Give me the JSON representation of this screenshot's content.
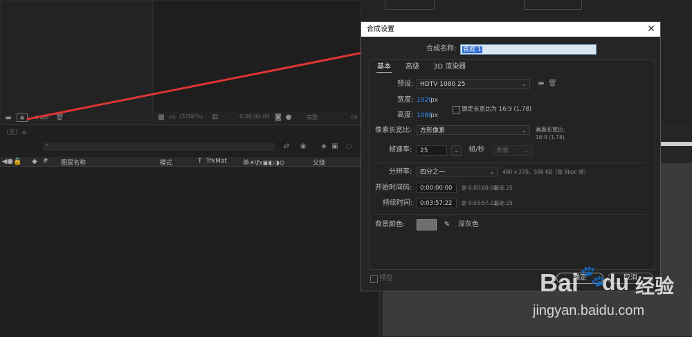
{
  "viewer": {
    "bpc_label": "8 bpc",
    "zoom_label": "(3700%)",
    "timecode": "0:00:00:00",
    "quality": "完整"
  },
  "timeline": {
    "comp_name": "（无）≡",
    "columns": {
      "hash": "#",
      "layer_name": "图层名称",
      "mode": "模式",
      "t": "T",
      "trkmat": "TrkMat",
      "switches": "单☀\\fx▣◐◑⊙",
      "parent": "父级"
    }
  },
  "dialog": {
    "title": "合成设置",
    "comp_name_label": "合成名称:",
    "comp_name_value": "合成 1",
    "tabs": [
      "基本",
      "高级",
      "3D 渲染器"
    ],
    "preset_label": "预设:",
    "preset_value": "HDTV 1080 25",
    "width_label": "宽度:",
    "width_value": "1920",
    "width_unit": "px",
    "height_label": "高度:",
    "height_value": "1080",
    "height_unit": "px",
    "lock_aspect_label": "锁定长宽比为 16:9 (1.78)",
    "pixel_aspect_label": "像素长宽比:",
    "pixel_aspect_value": "方形像素",
    "frame_aspect_label": "画面长宽比:",
    "frame_aspect_value": "16:9 (1.78)",
    "frame_rate_label": "帧速率:",
    "frame_rate_value": "25",
    "frame_rate_unit": "帧/秒",
    "drop_frame_value": "丢帧",
    "resolution_label": "分辨率:",
    "resolution_value": "四分之一",
    "resolution_info": "480 x 270，506 KB（每 8bpc 帧）",
    "start_tc_label": "开始时间码:",
    "start_tc_value": "0:00:00:00",
    "start_tc_info": "是 0:00:00:00",
    "start_tc_base": "基础 25",
    "duration_label": "持续时间:",
    "duration_value": "0:03:57:22",
    "duration_info": "是 0:03:57:22",
    "duration_base": "基础 25",
    "bg_color_label": "背景颜色:",
    "bg_color_name": "深灰色",
    "bg_color_hex": "#6e6e6e",
    "preview_label": "预览",
    "ok_label": "确定",
    "cancel_label": "取消"
  },
  "watermark": {
    "brand": "Bai",
    "brand2": "du",
    "brand_cn": "经验",
    "url": "jingyan.baidu.com"
  },
  "colors": {
    "arrow": "#e03434",
    "accent_blue": "#2d8ceb"
  }
}
